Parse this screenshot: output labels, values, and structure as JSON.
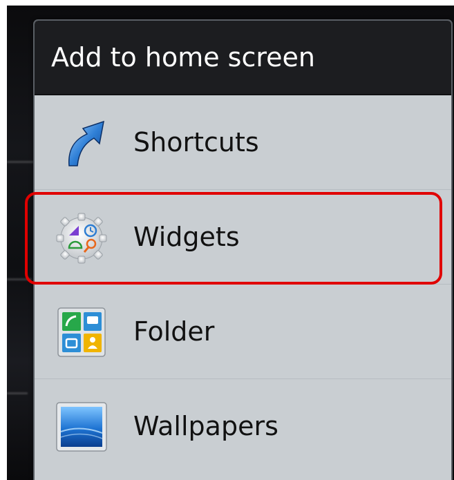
{
  "dialog": {
    "title": "Add to home screen",
    "items": [
      {
        "label": "Shortcuts",
        "icon": "shortcut-arrow-icon"
      },
      {
        "label": "Widgets",
        "icon": "widgets-gear-icon"
      },
      {
        "label": "Folder",
        "icon": "folder-grid-icon"
      },
      {
        "label": "Wallpapers",
        "icon": "wallpaper-icon"
      }
    ],
    "highlighted_item": "Widgets"
  },
  "colors": {
    "title_bar": "#1c1d20",
    "dialog_body": "#c9ced2",
    "highlight": "#e00000"
  }
}
